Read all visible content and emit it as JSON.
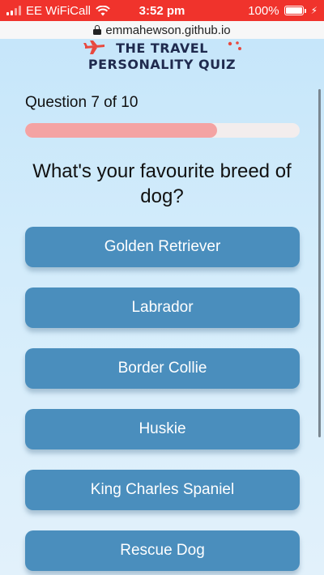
{
  "status_bar": {
    "carrier": "EE WiFiCall",
    "time": "3:52 pm",
    "battery": "100%",
    "battery_level": 1.0
  },
  "browser": {
    "url": "emmahewson.github.io"
  },
  "header": {
    "title_line1": "THE TRAVEL",
    "title_line2": "PERSONALITY QUIZ"
  },
  "quiz": {
    "question_count": "Question 7 of 10",
    "progress": 0.7,
    "question": "What's your favourite breed of dog?",
    "answers": [
      "Golden Retriever",
      "Labrador",
      "Border Collie",
      "Huskie",
      "King Charles Spaniel",
      "Rescue Dog"
    ]
  },
  "colors": {
    "status_bar": "#f0332c",
    "answer_button": "#4a8ebd",
    "progress_fill": "#f4a3a3",
    "progress_track": "#f3eded",
    "title": "#1f2a4e"
  }
}
